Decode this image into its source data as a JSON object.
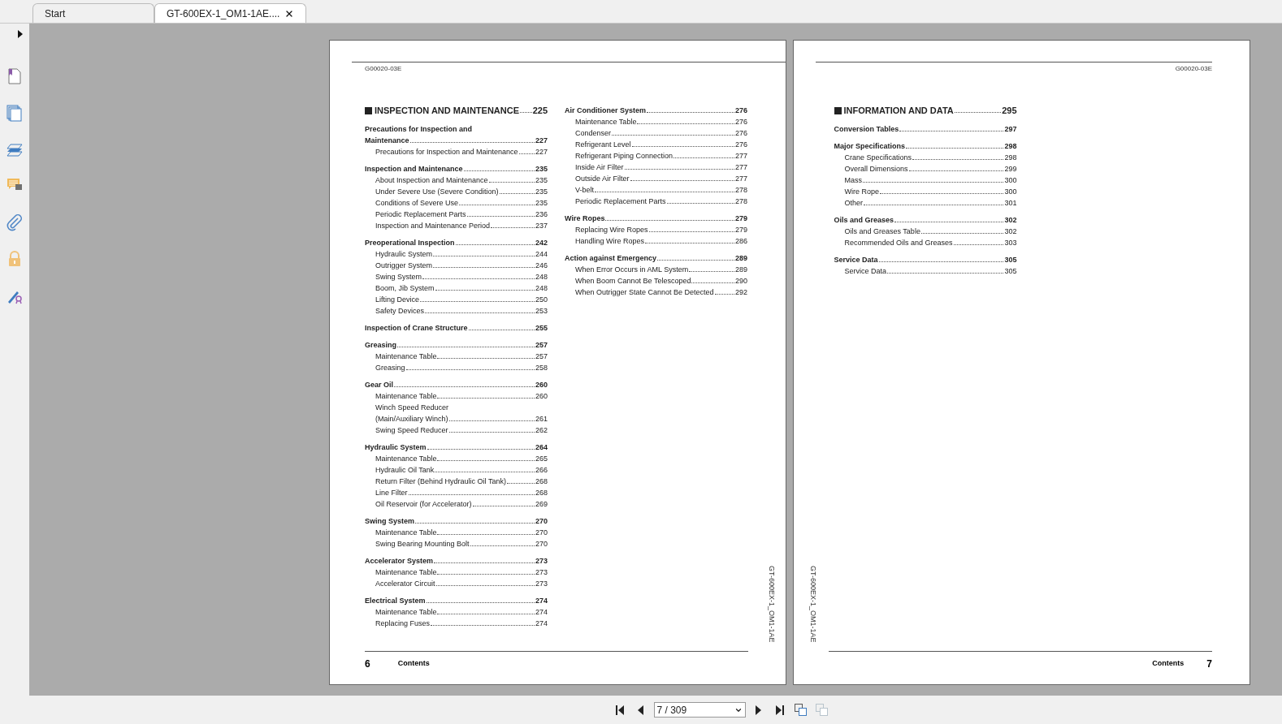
{
  "tabs": [
    {
      "label": "Start",
      "selected": false,
      "closable": false
    },
    {
      "label": "GT-600EX-1_OM1-1AE....",
      "selected": true,
      "closable": true
    }
  ],
  "pages": [
    {
      "code": "G00020-03E",
      "doc_id": "GT-600EX-1_OM1-1AE",
      "number": "6",
      "footer": "Contents",
      "columns": [
        [
          {
            "kind": "chapter",
            "lines": [
              "INSPECTION AND MAINTENANCE"
            ],
            "page": "225"
          },
          {
            "kind": "section",
            "lines": [
              "Precautions for Inspection and",
              "Maintenance"
            ],
            "page": "227"
          },
          {
            "kind": "item",
            "lines": [
              "Precautions for Inspection and Maintenance"
            ],
            "page": "227"
          },
          {
            "kind": "section",
            "lines": [
              "Inspection and Maintenance"
            ],
            "page": "235"
          },
          {
            "kind": "item",
            "lines": [
              "About Inspection and Maintenance"
            ],
            "page": "235"
          },
          {
            "kind": "item",
            "lines": [
              "Under Severe Use (Severe Condition)"
            ],
            "page": "235"
          },
          {
            "kind": "item",
            "lines": [
              "Conditions of Severe Use"
            ],
            "page": "235"
          },
          {
            "kind": "item",
            "lines": [
              "Periodic Replacement Parts"
            ],
            "page": "236"
          },
          {
            "kind": "item",
            "lines": [
              "Inspection and Maintenance Period"
            ],
            "page": "237"
          },
          {
            "kind": "section",
            "lines": [
              "Preoperational Inspection"
            ],
            "page": "242"
          },
          {
            "kind": "item",
            "lines": [
              "Hydraulic System"
            ],
            "page": "244"
          },
          {
            "kind": "item",
            "lines": [
              "Outrigger System"
            ],
            "page": "246"
          },
          {
            "kind": "item",
            "lines": [
              "Swing System"
            ],
            "page": "248"
          },
          {
            "kind": "item",
            "lines": [
              "Boom, Jib System"
            ],
            "page": "248"
          },
          {
            "kind": "item",
            "lines": [
              "Lifting Device"
            ],
            "page": "250"
          },
          {
            "kind": "item",
            "lines": [
              "Safety Devices"
            ],
            "page": "253"
          },
          {
            "kind": "section",
            "lines": [
              "Inspection of Crane Structure"
            ],
            "page": "255"
          },
          {
            "kind": "section",
            "lines": [
              "Greasing"
            ],
            "page": "257"
          },
          {
            "kind": "item",
            "lines": [
              "Maintenance Table"
            ],
            "page": "257"
          },
          {
            "kind": "item",
            "lines": [
              "Greasing"
            ],
            "page": "258"
          },
          {
            "kind": "section",
            "lines": [
              "Gear Oil"
            ],
            "page": "260"
          },
          {
            "kind": "item",
            "lines": [
              "Maintenance Table"
            ],
            "page": "260"
          },
          {
            "kind": "item",
            "lines": [
              "Winch Speed Reducer",
              "(Main/Auxiliary Winch)"
            ],
            "page": "261"
          },
          {
            "kind": "item",
            "lines": [
              "Swing Speed Reducer"
            ],
            "page": "262"
          },
          {
            "kind": "section",
            "lines": [
              "Hydraulic System"
            ],
            "page": "264"
          },
          {
            "kind": "item",
            "lines": [
              "Maintenance Table"
            ],
            "page": "265"
          },
          {
            "kind": "item",
            "lines": [
              "Hydraulic Oil Tank"
            ],
            "page": "266"
          },
          {
            "kind": "item",
            "lines": [
              "Return Filter (Behind Hydraulic Oil Tank)"
            ],
            "page": "268"
          },
          {
            "kind": "item",
            "lines": [
              "Line Filter"
            ],
            "page": "268"
          },
          {
            "kind": "item",
            "lines": [
              "Oil Reservoir (for Accelerator)"
            ],
            "page": "269"
          },
          {
            "kind": "section",
            "lines": [
              "Swing System"
            ],
            "page": "270"
          },
          {
            "kind": "item",
            "lines": [
              "Maintenance Table"
            ],
            "page": "270"
          },
          {
            "kind": "item",
            "lines": [
              "Swing Bearing Mounting Bolt"
            ],
            "page": "270"
          },
          {
            "kind": "section",
            "lines": [
              "Accelerator System"
            ],
            "page": "273"
          },
          {
            "kind": "item",
            "lines": [
              "Maintenance Table"
            ],
            "page": "273"
          },
          {
            "kind": "item",
            "lines": [
              "Accelerator Circuit"
            ],
            "page": "273"
          },
          {
            "kind": "section",
            "lines": [
              "Electrical System"
            ],
            "page": "274"
          },
          {
            "kind": "item",
            "lines": [
              "Maintenance Table"
            ],
            "page": "274"
          },
          {
            "kind": "item",
            "lines": [
              "Replacing Fuses"
            ],
            "page": "274"
          }
        ],
        [
          {
            "kind": "section",
            "lines": [
              "Air Conditioner System"
            ],
            "page": "276"
          },
          {
            "kind": "item",
            "lines": [
              "Maintenance Table"
            ],
            "page": "276"
          },
          {
            "kind": "item",
            "lines": [
              "Condenser"
            ],
            "page": "276"
          },
          {
            "kind": "item",
            "lines": [
              "Refrigerant Level"
            ],
            "page": "276"
          },
          {
            "kind": "item",
            "lines": [
              "Refrigerant Piping Connection"
            ],
            "page": "277"
          },
          {
            "kind": "item",
            "lines": [
              "Inside Air Filter"
            ],
            "page": "277"
          },
          {
            "kind": "item",
            "lines": [
              "Outside Air Filter"
            ],
            "page": "277"
          },
          {
            "kind": "item",
            "lines": [
              "V-belt"
            ],
            "page": "278"
          },
          {
            "kind": "item",
            "lines": [
              "Periodic Replacement Parts"
            ],
            "page": "278"
          },
          {
            "kind": "section",
            "lines": [
              "Wire Ropes"
            ],
            "page": "279"
          },
          {
            "kind": "item",
            "lines": [
              "Replacing Wire Ropes"
            ],
            "page": "279"
          },
          {
            "kind": "item",
            "lines": [
              "Handling Wire Ropes"
            ],
            "page": "286"
          },
          {
            "kind": "section",
            "lines": [
              "Action against Emergency"
            ],
            "page": "289"
          },
          {
            "kind": "item",
            "lines": [
              "When Error Occurs in AML System"
            ],
            "page": "289"
          },
          {
            "kind": "item",
            "lines": [
              "When Boom Cannot Be Telescoped"
            ],
            "page": "290"
          },
          {
            "kind": "item",
            "lines": [
              "When Outrigger State Cannot Be Detected"
            ],
            "page": "292"
          }
        ]
      ]
    },
    {
      "code": "G00020-03E",
      "doc_id": "GT-600EX-1_OM1-1AE",
      "number": "7",
      "footer": "Contents",
      "columns": [
        [
          {
            "kind": "chapter",
            "lines": [
              "INFORMATION AND DATA"
            ],
            "page": "295"
          },
          {
            "kind": "section",
            "lines": [
              "Conversion Tables"
            ],
            "page": "297"
          },
          {
            "kind": "section",
            "lines": [
              "Major Specifications"
            ],
            "page": "298"
          },
          {
            "kind": "item",
            "lines": [
              "Crane Specifications"
            ],
            "page": "298"
          },
          {
            "kind": "item",
            "lines": [
              "Overall Dimensions"
            ],
            "page": "299"
          },
          {
            "kind": "item",
            "lines": [
              "Mass"
            ],
            "page": "300"
          },
          {
            "kind": "item",
            "lines": [
              "Wire Rope"
            ],
            "page": "300"
          },
          {
            "kind": "item",
            "lines": [
              "Other"
            ],
            "page": "301"
          },
          {
            "kind": "section",
            "lines": [
              "Oils and Greases"
            ],
            "page": "302"
          },
          {
            "kind": "item",
            "lines": [
              "Oils and Greases Table"
            ],
            "page": "302"
          },
          {
            "kind": "item",
            "lines": [
              "Recommended Oils and Greases"
            ],
            "page": "303"
          },
          {
            "kind": "section",
            "lines": [
              "Service Data"
            ],
            "page": "305"
          },
          {
            "kind": "item",
            "lines": [
              "Service Data"
            ],
            "page": "305"
          }
        ]
      ]
    }
  ],
  "navigation": {
    "buttons_before": [
      {
        "kind": "first",
        "disabled": false
      },
      {
        "kind": "previous",
        "disabled": false
      }
    ],
    "page_field": {
      "value": "7 / 309"
    },
    "buttons_after": [
      {
        "kind": "next",
        "disabled": false
      },
      {
        "kind": "last",
        "disabled": false
      },
      {
        "kind": "view-a",
        "disabled": false
      },
      {
        "kind": "view-b",
        "disabled": true
      }
    ]
  }
}
